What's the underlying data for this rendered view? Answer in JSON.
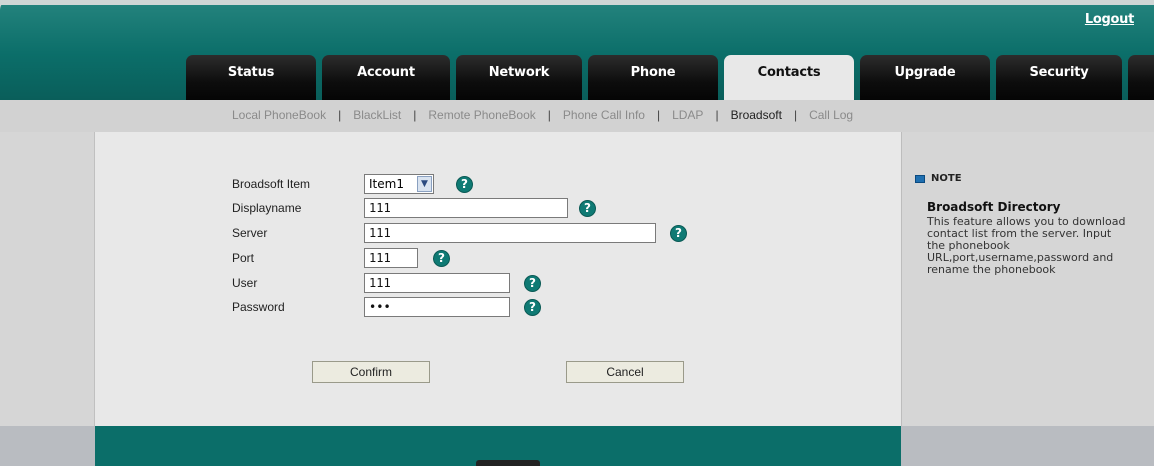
{
  "header": {
    "logout": "Logout",
    "tabs": [
      "Status",
      "Account",
      "Network",
      "Phone",
      "Contacts",
      "Upgrade",
      "Security"
    ],
    "active_tab": "Contacts"
  },
  "subnav": {
    "items": [
      "Local PhoneBook",
      "BlackList",
      "Remote PhoneBook",
      "Phone Call Info",
      "LDAP",
      "Broadsoft",
      "Call Log"
    ],
    "active": "Broadsoft"
  },
  "form": {
    "item": {
      "label": "Broadsoft Item",
      "value": "Item1"
    },
    "displayname": {
      "label": "Displayname",
      "value": "111"
    },
    "server": {
      "label": "Server",
      "value": "111"
    },
    "port": {
      "label": "Port",
      "value": "111"
    },
    "user": {
      "label": "User",
      "value": "111"
    },
    "password": {
      "label": "Password",
      "value": "•••"
    },
    "help_glyph": "?"
  },
  "buttons": {
    "confirm": "Confirm",
    "cancel": "Cancel"
  },
  "note": {
    "heading": "NOTE",
    "title": "Broadsoft Directory",
    "body": "This feature allows you to download contact list from the server. Input the phonebook URL,port,username,password and rename the phonebook"
  },
  "colors": {
    "teal": "#0b6e69",
    "tab_black": "#0d0d0d",
    "help": "#0f7a74"
  }
}
